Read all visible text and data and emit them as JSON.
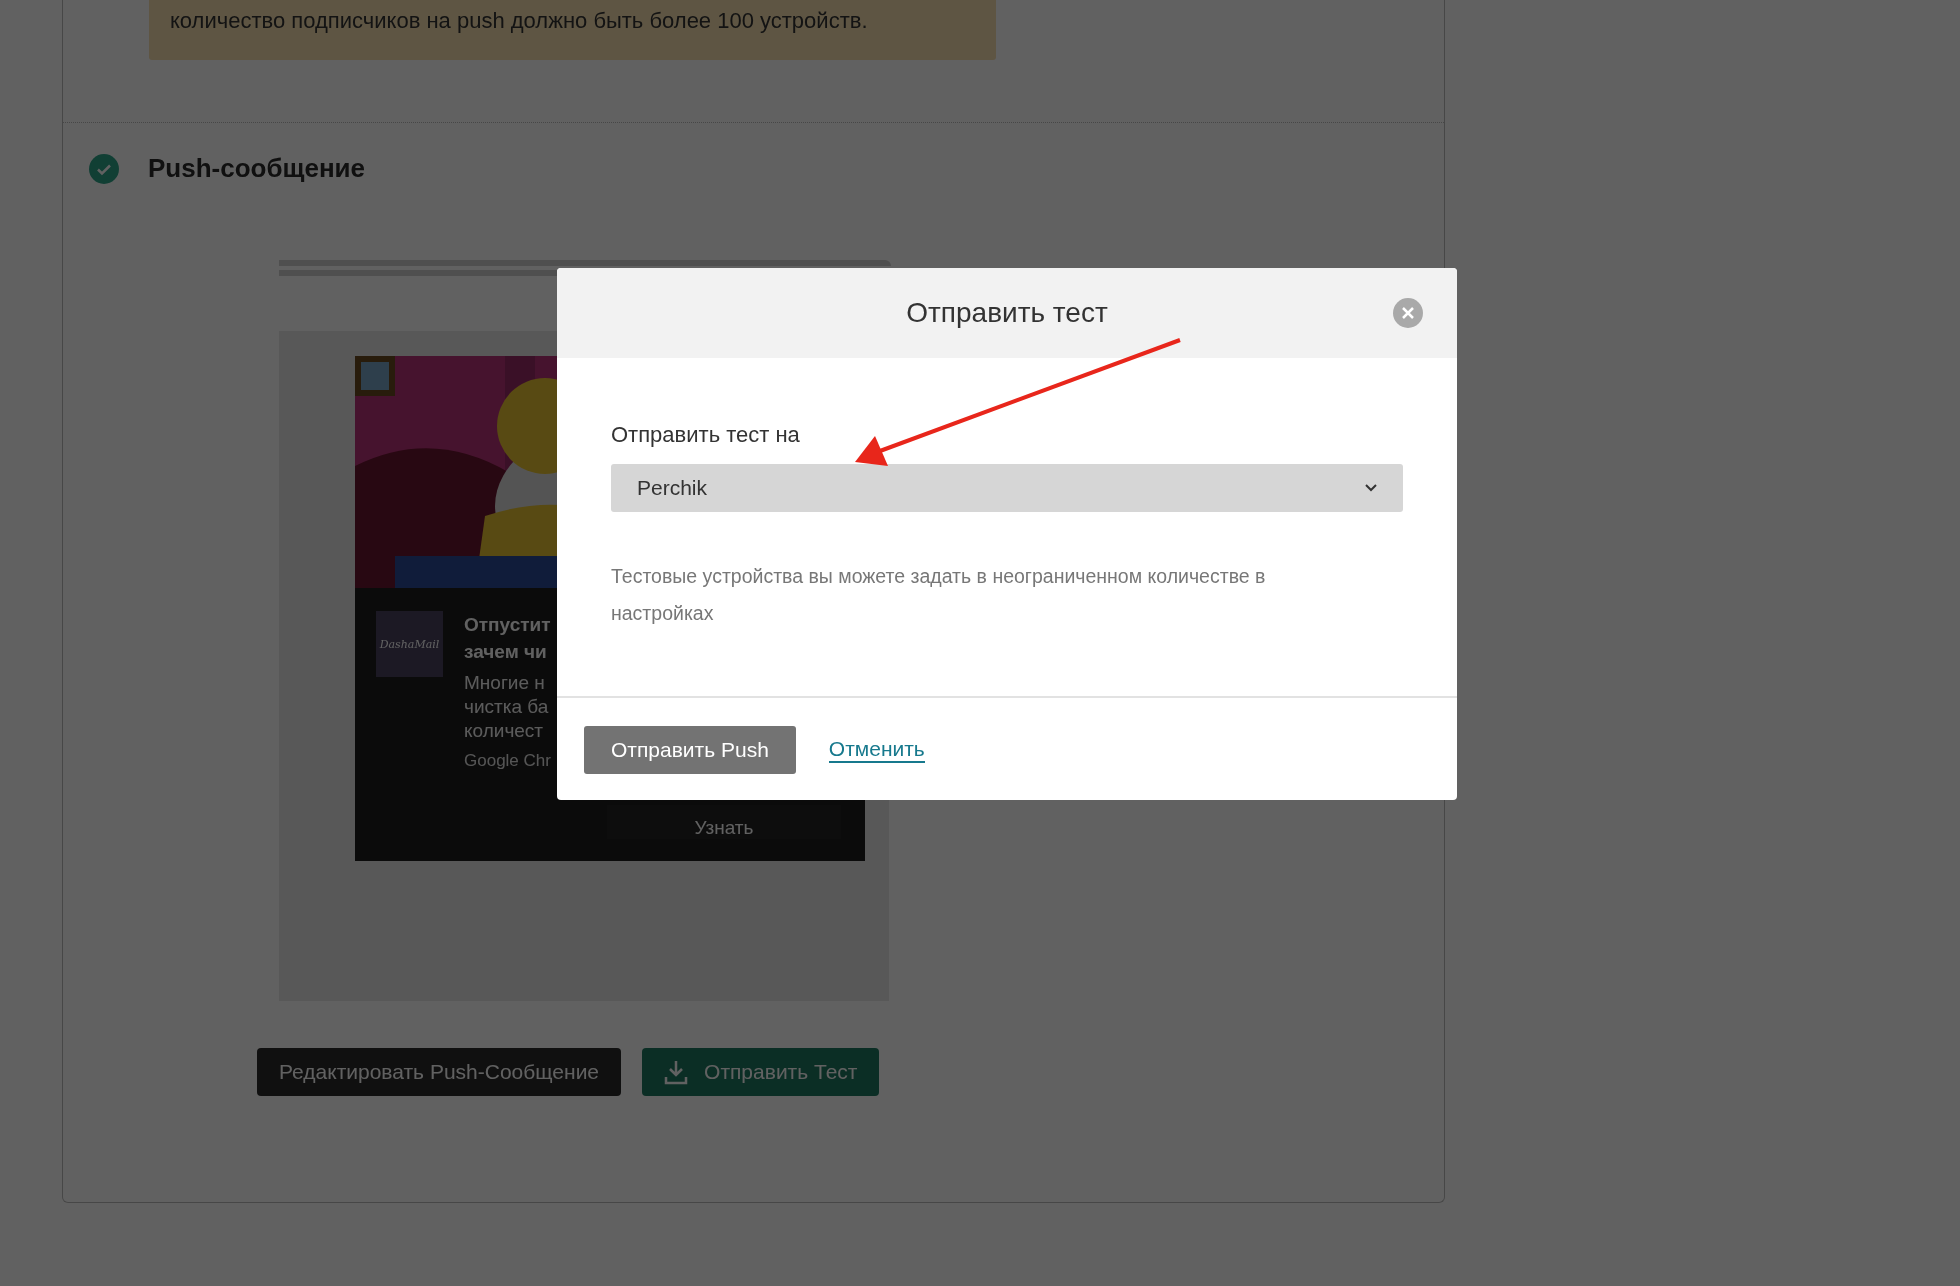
{
  "background": {
    "notice": "количество подписчиков на push должно быть более 100 устройств.",
    "section": {
      "title": "Push-сообщение",
      "done": true
    },
    "preview": {
      "sender_logo": "DashaMail",
      "title_lines": [
        "Отпустит",
        "зачем чи"
      ],
      "body_lines": [
        "Многие н",
        "чистка ба",
        "количест"
      ],
      "source": "Google Chr",
      "action": "Узнать"
    },
    "buttons": [
      {
        "label": "Редактировать Push-Сообщение",
        "kind": "dark"
      },
      {
        "label": "Отправить Тест",
        "kind": "test"
      }
    ]
  },
  "modal": {
    "title": "Отправить тест",
    "field_label": "Отправить тест на",
    "select_value": "Perchik",
    "help": "Тестовые устройства вы можете задать в неограниченном количестве в настройках",
    "primary": "Отправить Push",
    "cancel": "Отменить"
  }
}
